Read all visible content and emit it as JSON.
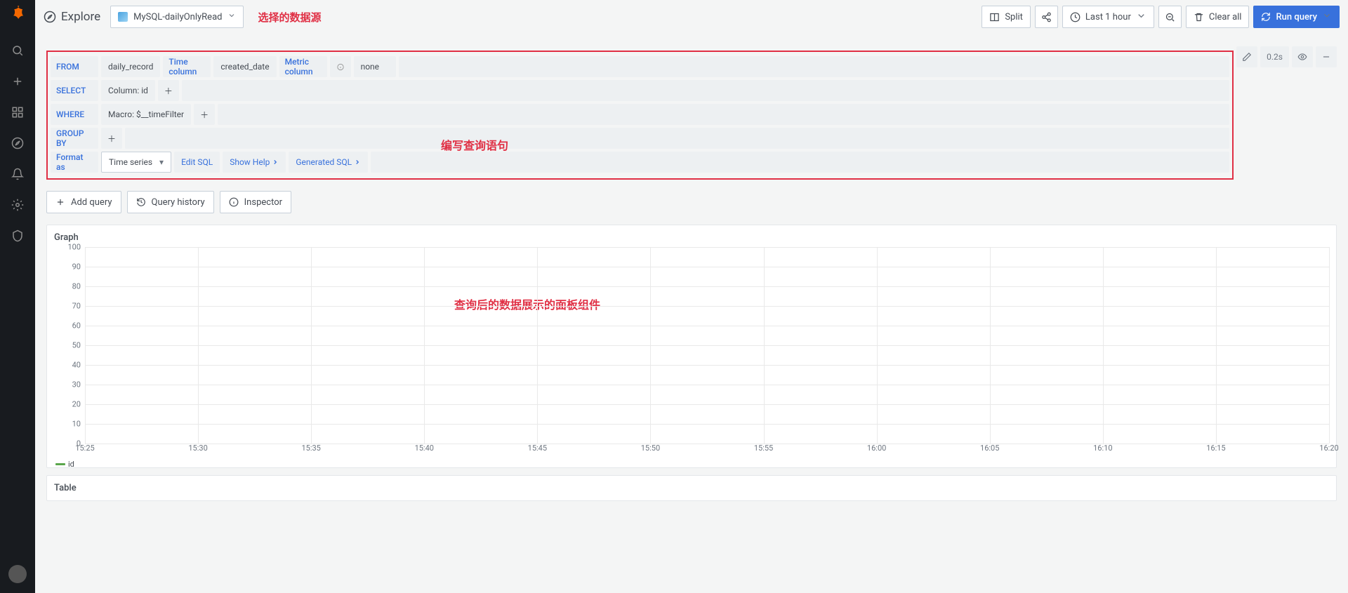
{
  "page": {
    "title": "Explore"
  },
  "datasource": {
    "name": "MySQL-dailyOnlyRead"
  },
  "annotations": {
    "datasource": "选择的数据源",
    "query": "编写查询语句",
    "panel": "查询后的数据展示的面板组件"
  },
  "toolbar": {
    "split": "Split",
    "time_range": "Last 1 hour",
    "clear": "Clear all",
    "run": "Run query"
  },
  "query": {
    "from_label": "FROM",
    "from_value": "daily_record",
    "time_col_label": "Time column",
    "time_col_value": "created_date",
    "metric_col_label": "Metric column",
    "metric_col_value": "none",
    "select_label": "SELECT",
    "select_value": "Column: id",
    "where_label": "WHERE",
    "where_value": "Macro: $__timeFilter",
    "groupby_label": "GROUP BY",
    "format_label": "Format as",
    "format_value": "Time series",
    "edit_sql": "Edit SQL",
    "show_help": "Show Help",
    "generated_sql": "Generated SQL",
    "exec_time": "0.2s"
  },
  "actions": {
    "add_query": "Add query",
    "query_history": "Query history",
    "inspector": "Inspector"
  },
  "graph": {
    "title": "Graph",
    "legend_series": "id"
  },
  "table": {
    "title": "Table"
  },
  "chart_data": {
    "type": "line",
    "x": [
      "15:25",
      "15:30",
      "15:35",
      "15:40",
      "15:45",
      "15:50",
      "15:55",
      "16:00",
      "16:05",
      "16:10",
      "16:15",
      "16:20"
    ],
    "series": [
      {
        "name": "id",
        "values": []
      }
    ],
    "y_ticks": [
      0,
      10,
      20,
      30,
      40,
      50,
      60,
      70,
      80,
      90,
      100
    ],
    "ylim": [
      0,
      100
    ],
    "xlabel": "",
    "ylabel": "",
    "title": ""
  }
}
